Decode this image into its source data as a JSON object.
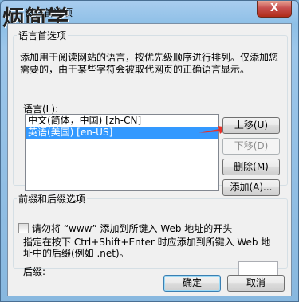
{
  "window": {
    "title": "语言首选项",
    "close_glyph": "X",
    "watermark_logo": "炳简学"
  },
  "preference_group": {
    "legend": "语言首选项",
    "description": "添加用于阅读网站的语言，按优先级顺序进行排列。仅添加您需要的，由于某些字符会被取代网页的正确语言显示。",
    "language_label": "语言(L):",
    "languages": [
      {
        "label": "中文(简体，中国) [zh-CN]",
        "selected": false
      },
      {
        "label": "英语(美国) [en-US]",
        "selected": true
      }
    ]
  },
  "buttons": {
    "move_up": "上移(U)",
    "move_down": "下移(D)",
    "remove": "删除(M)",
    "add": "添加(A)...",
    "ok": "确定",
    "cancel": "取消"
  },
  "prefix_suffix_group": {
    "legend": "前缀和后缀选项",
    "checkbox_label": "请勿将 “www” 添加到所键入 Web 地址的开头",
    "hint": "指定在按下 Ctrl+Shift+Enter 时应添加到所键入 Web 地址中的后缀(例如 .net)。",
    "suffix_label": "后缀:",
    "suffix_value": ""
  },
  "colors": {
    "selection": "#3399ff",
    "arrow": "#e8302a"
  }
}
